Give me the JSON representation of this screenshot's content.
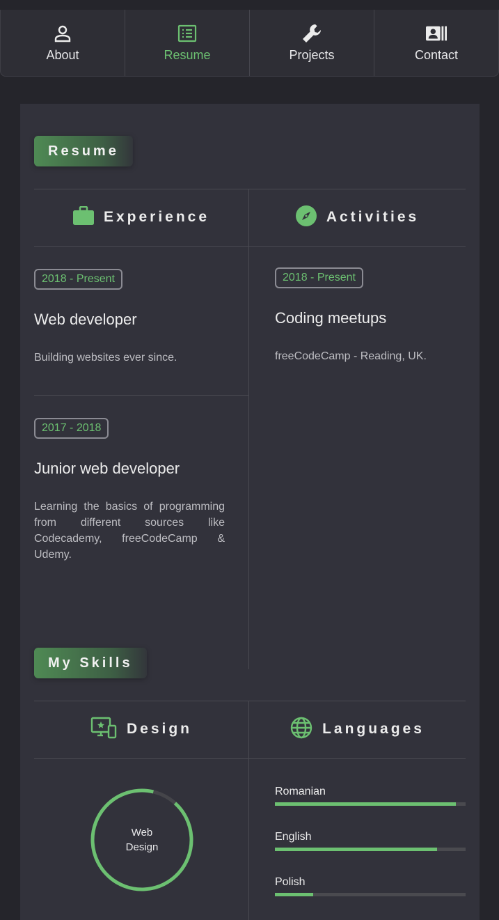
{
  "nav": {
    "items": [
      {
        "label": "About",
        "icon": "user-icon"
      },
      {
        "label": "Resume",
        "icon": "list-icon"
      },
      {
        "label": "Projects",
        "icon": "wrench-icon"
      },
      {
        "label": "Contact",
        "icon": "contact-card-icon"
      }
    ],
    "active": "Resume"
  },
  "resume": {
    "section_title": "Resume",
    "experience": {
      "title": "Experience",
      "icon": "briefcase-icon",
      "entries": [
        {
          "date": "2018 - Present",
          "title": "Web developer",
          "desc": "Building websites ever since."
        },
        {
          "date": "2017 - 2018",
          "title": "Junior web developer",
          "desc": "Learning the basics of programming from different sources like Codecademy, freeCodeCamp & Udemy."
        }
      ]
    },
    "activities": {
      "title": "Activities",
      "icon": "compass-icon",
      "entries": [
        {
          "date": "2018 - Present",
          "title": "Coding meetups",
          "desc": "freeCodeCamp - Reading, UK."
        }
      ]
    }
  },
  "skills": {
    "section_title": "My Skills",
    "design": {
      "title": "Design",
      "icon": "devices-icon",
      "ring": {
        "line1": "Web",
        "line2": "Design",
        "level": 0.92
      }
    },
    "languages": {
      "title": "Languages",
      "icon": "globe-icon",
      "items": [
        {
          "name": "Romanian",
          "level": 0.95
        },
        {
          "name": "English",
          "level": 0.85
        },
        {
          "name": "Polish",
          "level": 0.2
        }
      ]
    }
  },
  "colors": {
    "accent": "#6cc071",
    "background": "#25252b",
    "card": "#32323b"
  }
}
